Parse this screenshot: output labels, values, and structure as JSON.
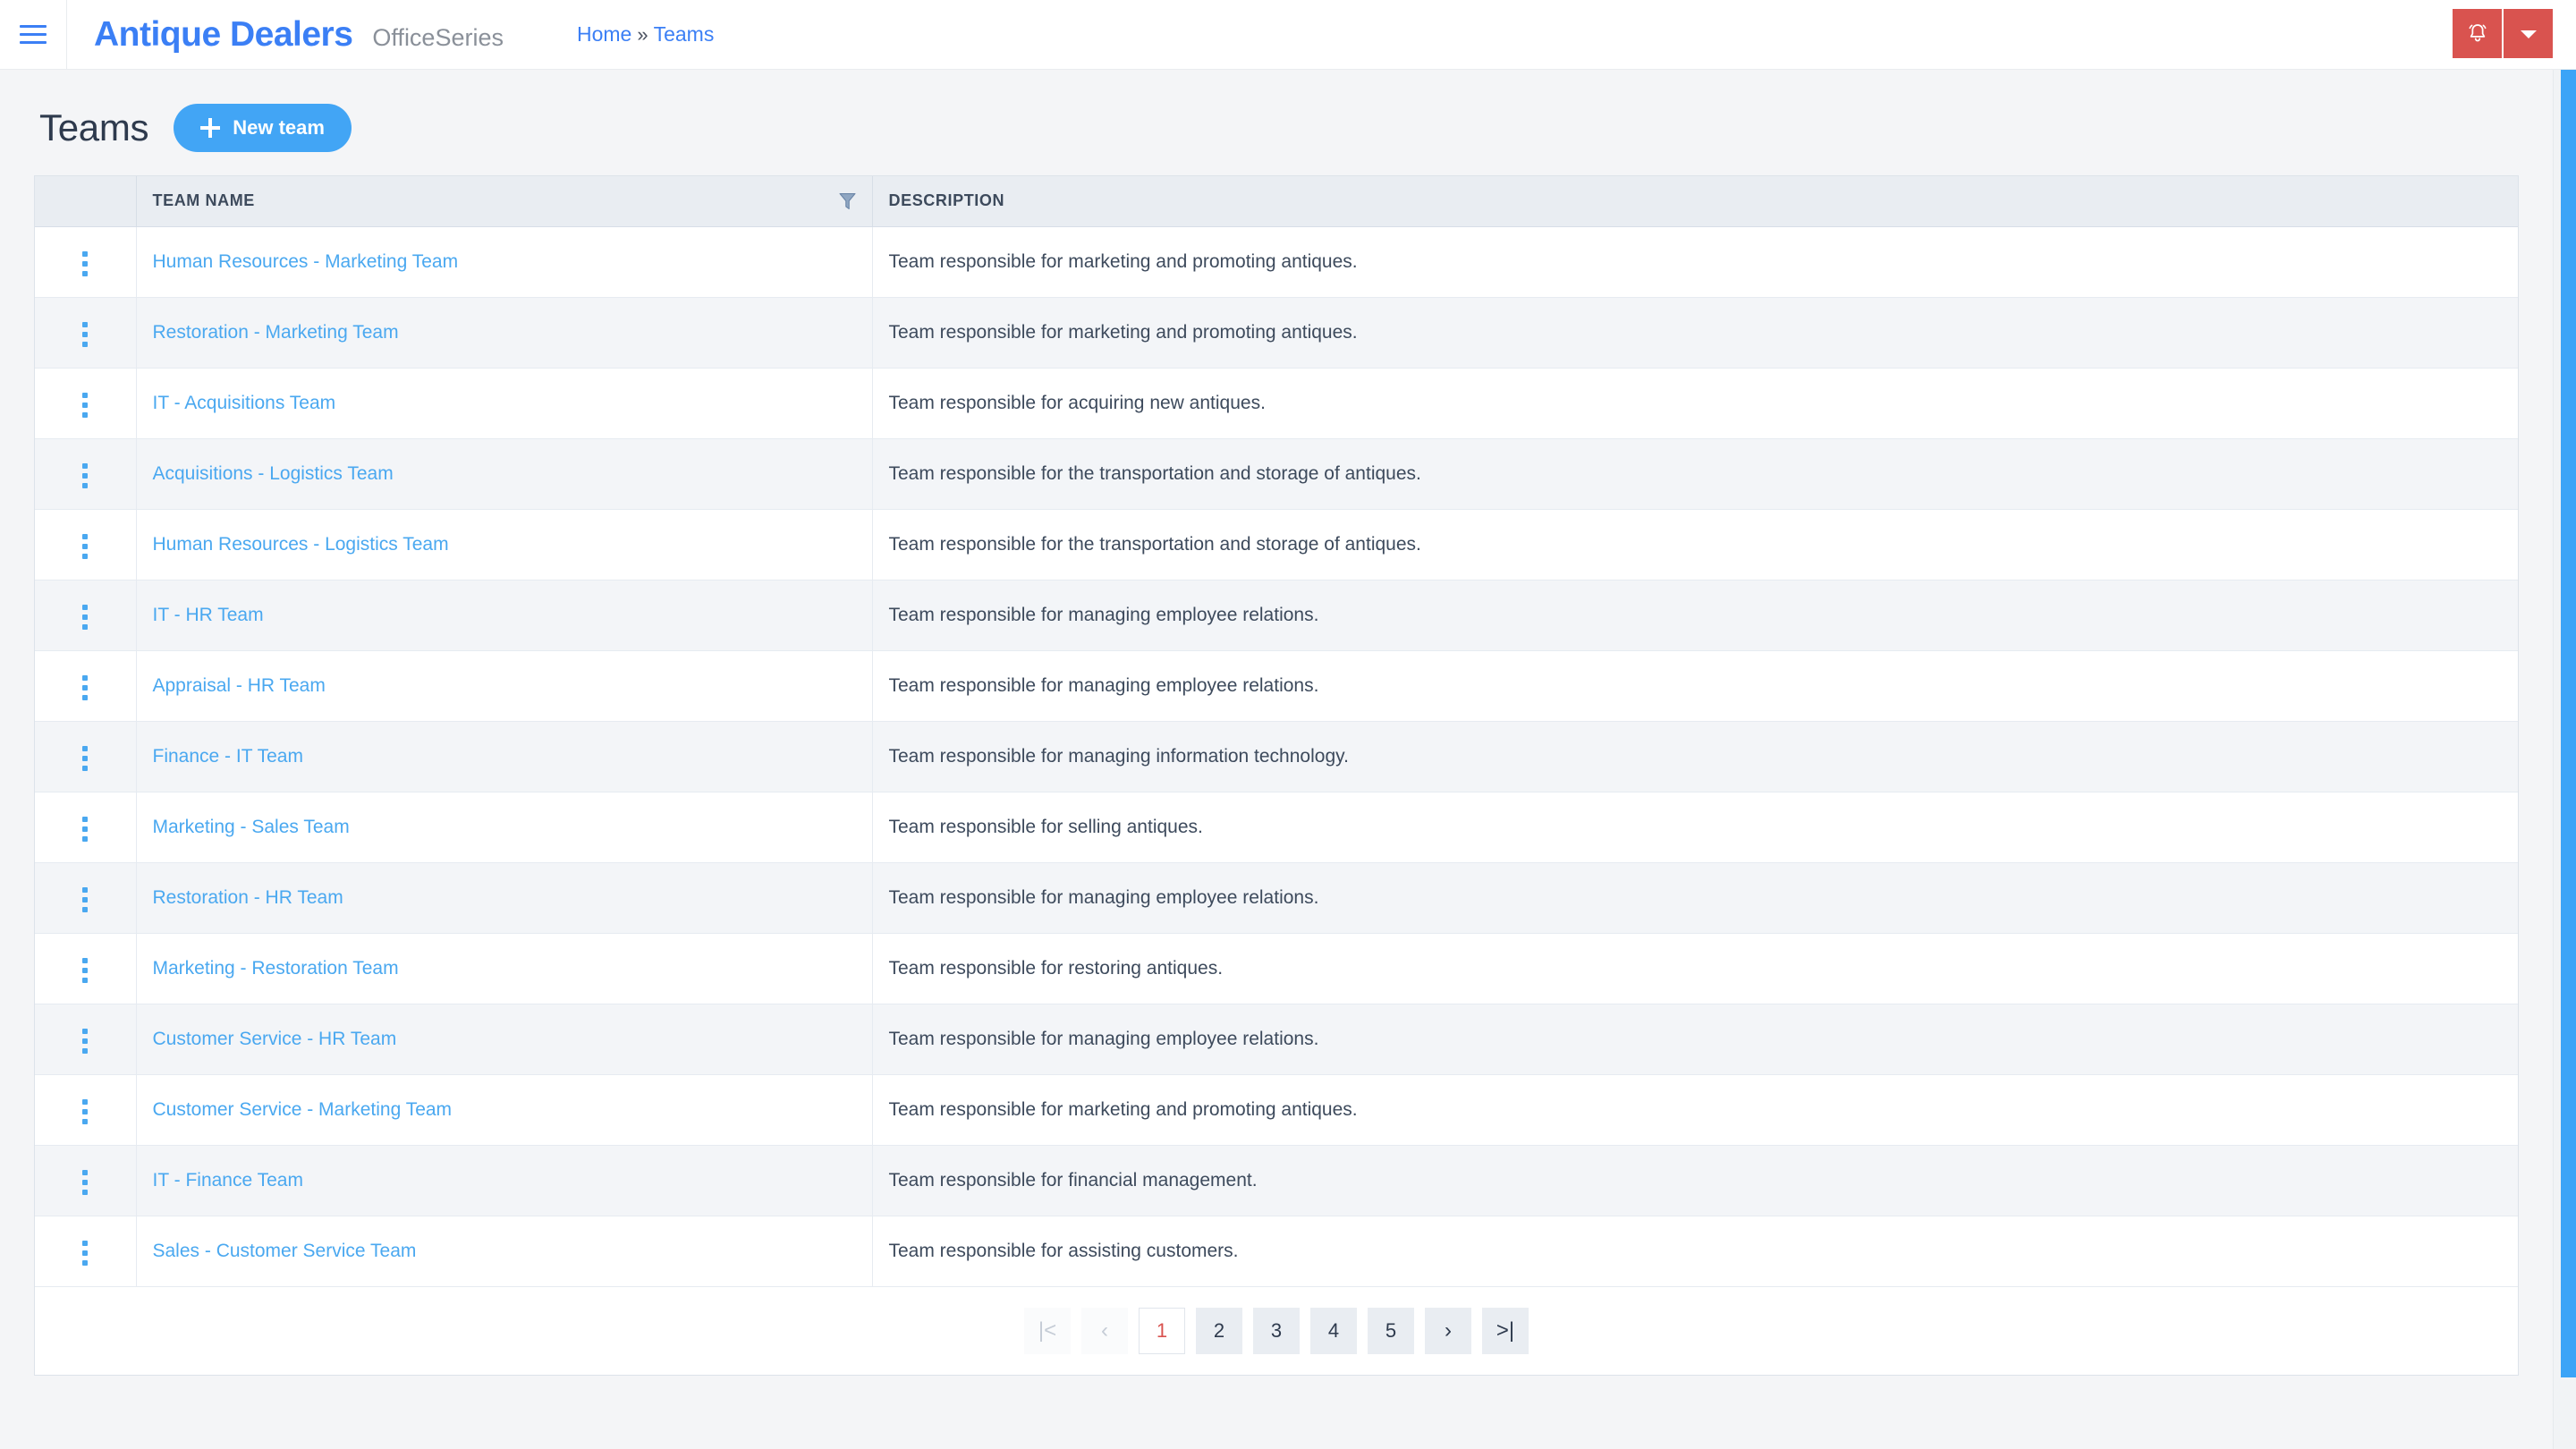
{
  "topbar": {
    "menu_icon": "hamburger-icon",
    "brand": "Antique Dealers",
    "brand_sub": "OfficeSeries",
    "breadcrumb": {
      "home": "Home",
      "separator": "»",
      "current": "Teams"
    },
    "notification_icon": "bell-icon",
    "dropdown_icon": "caret-down-icon",
    "accent_color": "#3b7ff5",
    "action_color": "#d9534f"
  },
  "page": {
    "title": "Teams",
    "new_button_label": "New team",
    "new_button_icon": "plus-icon",
    "new_button_color": "#42a5f5"
  },
  "table": {
    "columns": [
      "",
      "TEAM NAME",
      "DESCRIPTION"
    ],
    "filter_icon": "funnel-icon",
    "row_menu_icon": "kebab-menu-icon",
    "link_color": "#4aa8f0",
    "rows": [
      {
        "name": "Human Resources - Marketing Team",
        "description": "Team responsible for marketing and promoting antiques."
      },
      {
        "name": "Restoration - Marketing Team",
        "description": "Team responsible for marketing and promoting antiques."
      },
      {
        "name": "IT - Acquisitions Team",
        "description": "Team responsible for acquiring new antiques."
      },
      {
        "name": "Acquisitions - Logistics Team",
        "description": "Team responsible for the transportation and storage of antiques."
      },
      {
        "name": "Human Resources - Logistics Team",
        "description": "Team responsible for the transportation and storage of antiques."
      },
      {
        "name": "IT - HR Team",
        "description": "Team responsible for managing employee relations."
      },
      {
        "name": "Appraisal - HR Team",
        "description": "Team responsible for managing employee relations."
      },
      {
        "name": "Finance - IT Team",
        "description": "Team responsible for managing information technology."
      },
      {
        "name": "Marketing - Sales Team",
        "description": "Team responsible for selling antiques."
      },
      {
        "name": "Restoration - HR Team",
        "description": "Team responsible for managing employee relations."
      },
      {
        "name": "Marketing - Restoration Team",
        "description": "Team responsible for restoring antiques."
      },
      {
        "name": "Customer Service - HR Team",
        "description": "Team responsible for managing employee relations."
      },
      {
        "name": "Customer Service - Marketing Team",
        "description": "Team responsible for marketing and promoting antiques."
      },
      {
        "name": "IT - Finance Team",
        "description": "Team responsible for financial management."
      },
      {
        "name": "Sales - Customer Service Team",
        "description": "Team responsible for assisting customers."
      }
    ]
  },
  "pagination": {
    "first_label": "|<",
    "prev_label": "‹",
    "next_label": "›",
    "last_label": ">|",
    "pages": [
      "1",
      "2",
      "3",
      "4",
      "5"
    ],
    "active_page": "1",
    "active_color": "#d9534f"
  }
}
